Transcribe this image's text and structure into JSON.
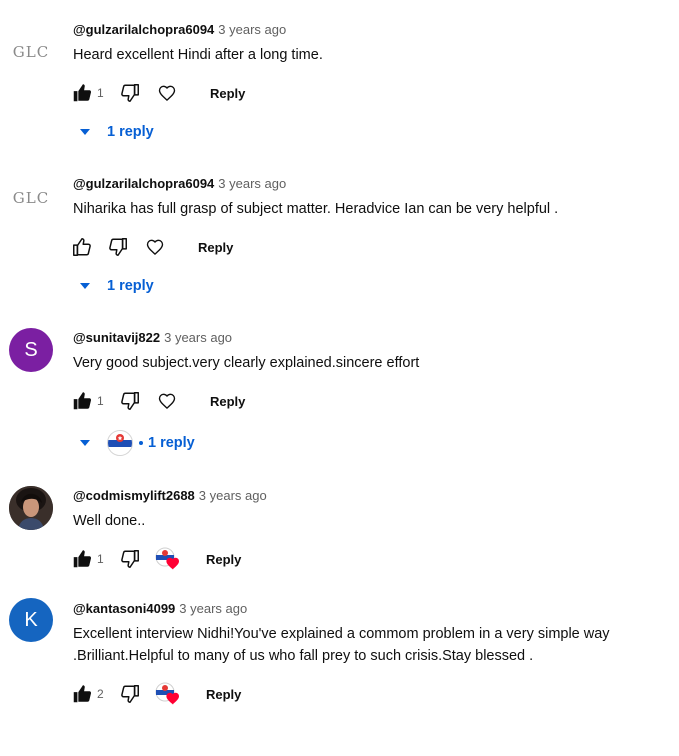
{
  "comments": [
    {
      "avatar": {
        "type": "logo",
        "text": "GLC"
      },
      "author": "@gulzarilalchopra6094",
      "time": "3 years ago",
      "text": "Heard excellent Hindi after a long time.",
      "likes": "1",
      "liked": true,
      "reply_label": "Reply",
      "replies_label": "1 reply"
    },
    {
      "avatar": {
        "type": "logo",
        "text": "GLC"
      },
      "author": "@gulzarilalchopra6094",
      "time": "3 years ago",
      "text": "Niharika has full grasp of subject matter. Heradvice Ian can be very helpful .",
      "likes": "",
      "liked": false,
      "reply_label": "Reply",
      "replies_label": "1 reply"
    },
    {
      "avatar": {
        "type": "letter",
        "text": "S",
        "color": "#7b1fa2"
      },
      "author": "@sunitavij822",
      "time": "3 years ago",
      "text": "Very good subject.very clearly explained.sincere effort",
      "likes": "1",
      "liked": true,
      "reply_label": "Reply",
      "replies_label": "1 reply"
    },
    {
      "avatar": {
        "type": "photo"
      },
      "author": "@codmismylift2688",
      "time": "3 years ago",
      "text": "Well done..",
      "likes": "1",
      "liked": true,
      "reply_label": "Reply"
    },
    {
      "avatar": {
        "type": "letter",
        "text": "K",
        "color": "#1565c0"
      },
      "author": "@kantasoni4099",
      "time": "3 years ago",
      "text": "Excellent interview Nidhi!You've explained a  commom problem in a very simple way .Brilliant.Helpful to many of us who fall prey to such crisis.Stay blessed .",
      "likes": "2",
      "liked": true,
      "reply_label": "Reply"
    }
  ],
  "colors": {
    "link_blue": "#065fd4",
    "heart_red": "#ff0033",
    "creator_badge_blue": "#1f4fb5"
  }
}
